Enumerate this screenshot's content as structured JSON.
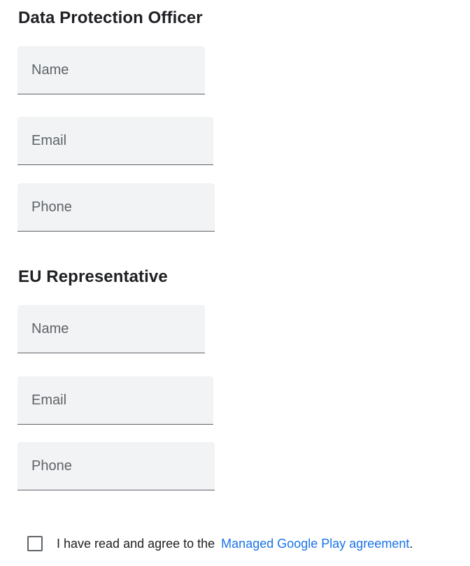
{
  "dpo": {
    "title": "Data Protection Officer",
    "name_placeholder": "Name",
    "email_placeholder": "Email",
    "phone_placeholder": "Phone"
  },
  "eu_rep": {
    "title": "EU Representative",
    "name_placeholder": "Name",
    "email_placeholder": "Email",
    "phone_placeholder": "Phone"
  },
  "agreement": {
    "text": "I have read and agree to the",
    "link_text": "Managed Google Play agreement",
    "suffix": "."
  },
  "colors": {
    "field_background": "#f1f3f4",
    "field_underline": "#5f6368",
    "link": "#1a73e8",
    "text": "#202124"
  }
}
